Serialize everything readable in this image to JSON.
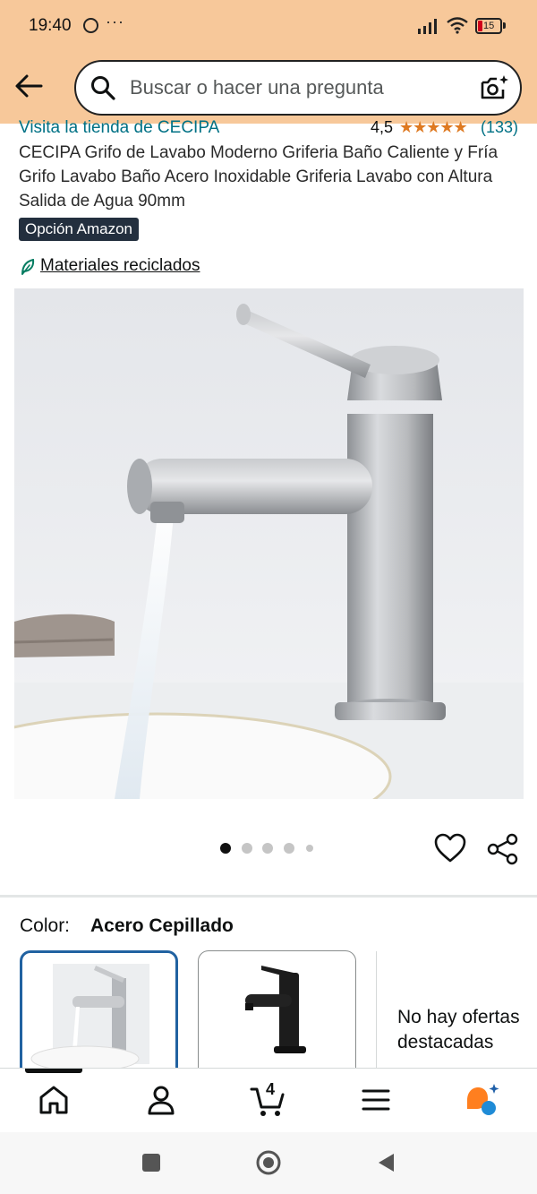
{
  "status_bar": {
    "time": "19:40",
    "more": "···",
    "battery": "15"
  },
  "search": {
    "placeholder": "Buscar o hacer una pregunta"
  },
  "product": {
    "store_link": "Visita la tienda de CECIPA",
    "rating": "4,5",
    "stars": "★★★★★",
    "rating_value": 4.5,
    "rating_count": "(133)",
    "title": "CECIPA Grifo de Lavabo Moderno Griferia Baño Caliente y Fría Grifo Lavabo Baño Acero Inoxidable Griferia Lavabo con Altura Salida de Agua 90mm",
    "badge": "Opción Amazon",
    "recycled_label": "Materiales reciclados",
    "image_count": 5,
    "active_image": 1
  },
  "variation": {
    "label": "Color:",
    "selected": "Acero Cepillado",
    "no_offers": "No hay ofertas destacadas"
  },
  "bottom_nav": {
    "cart_count": "4",
    "items": [
      "home-icon",
      "account-icon",
      "cart-icon",
      "menu-icon",
      "rufus-icon"
    ]
  },
  "colors": {
    "header_bg": "#f7c89a",
    "link": "#007185",
    "star": "#de7921",
    "badge_bg": "#232f3e",
    "selected_swatch": "#2162a1",
    "rufus": "#ff7f1f"
  }
}
